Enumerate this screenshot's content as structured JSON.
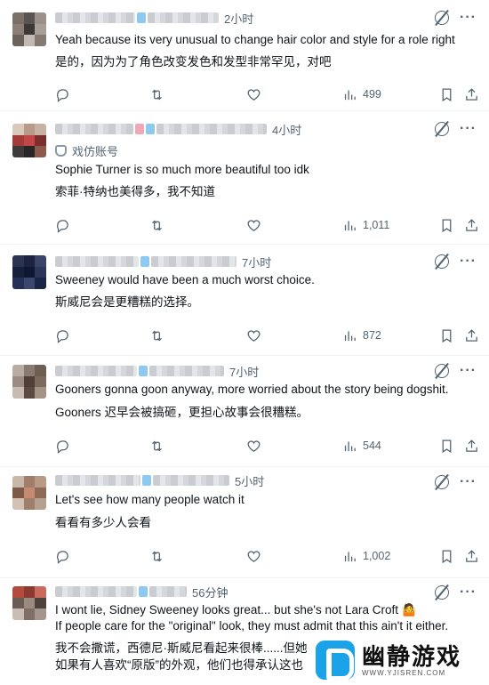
{
  "tweets": [
    {
      "time": "2小时",
      "badge": "",
      "text_en": "Yeah because its very unusual to change hair color and style for a role right",
      "text_zh": "是的，因为为了角色改变发色和发型非常罕见，对吧",
      "views": "499",
      "avatar_colors": [
        "#7b7066",
        "#5b534e",
        "#9b918a",
        "#8c7e77",
        "#3d3834",
        "#a89f99",
        "#6c625c",
        "#c2b9b2",
        "#857a73"
      ]
    },
    {
      "time": "4小时",
      "badge": "戏仿账号",
      "text_en": "Sophie Turner is so much more beautiful too idk",
      "text_zh": "索菲·特纳也美得多，我不知道",
      "views": "1,011",
      "avatar_colors": [
        "#d9c9bd",
        "#b79a88",
        "#c8b2a3",
        "#a53a3a",
        "#c24848",
        "#7a2e2e",
        "#3f3a3a",
        "#2b2626",
        "#8c5a4d"
      ]
    },
    {
      "time": "7小时",
      "badge": "",
      "text_en": "Sweeney would have been a much worst choice.",
      "text_zh": "斯威尼会是更糟糕的选择。",
      "views": "872",
      "avatar_colors": [
        "#2a3350",
        "#1c2340",
        "#3b4466",
        "#16203a",
        "#0f1833",
        "#2c3658",
        "#243055",
        "#3a466e",
        "#1a2445"
      ]
    },
    {
      "time": "7小时",
      "badge": "",
      "text_en": "Gooners gonna goon anyway, more worried about the story being dogshit.",
      "text_zh": "Gooners 迟早会被搞砸，更担心故事会很糟糕。",
      "views": "544",
      "avatar_colors": [
        "#b9aca3",
        "#8a7b71",
        "#6e5f55",
        "#9c8b80",
        "#4f3f36",
        "#7d6a5e",
        "#c7bbb2",
        "#5c4b41",
        "#a29386"
      ]
    },
    {
      "time": "5小时",
      "badge": "",
      "text_en": "Let's see how many people watch it",
      "text_zh": "看看有多少人会看",
      "views": "1,002",
      "avatar_colors": [
        "#c9b7a8",
        "#a07e6a",
        "#b89a86",
        "#7e5948",
        "#c58b70",
        "#8e6b57",
        "#d3c2b4",
        "#9d7f6b",
        "#b5a190"
      ]
    },
    {
      "time": "56分钟",
      "badge": "",
      "text_en": "I wont lie, Sidney Sweeney looks great... but she's not Lara Croft 🤷",
      "text_en_2": "If people care for the \"original\" look, they must admit that this ain't it either.",
      "text_zh": "我不会撒谎，西德尼·斯威尼看起来很棒......但她",
      "text_zh_2": "如果有人喜欢“原版”的外观，他们也得承认这也",
      "views": "",
      "avatar_colors": [
        "#b34a3e",
        "#8c3a31",
        "#c86a5c",
        "#6a5c55",
        "#9c8a80",
        "#4d413b",
        "#c9bdb4",
        "#7f6f66",
        "#a4968c"
      ]
    }
  ],
  "watermark": {
    "title": "幽静游戏",
    "url": "WWW.YJISREN.COM"
  }
}
